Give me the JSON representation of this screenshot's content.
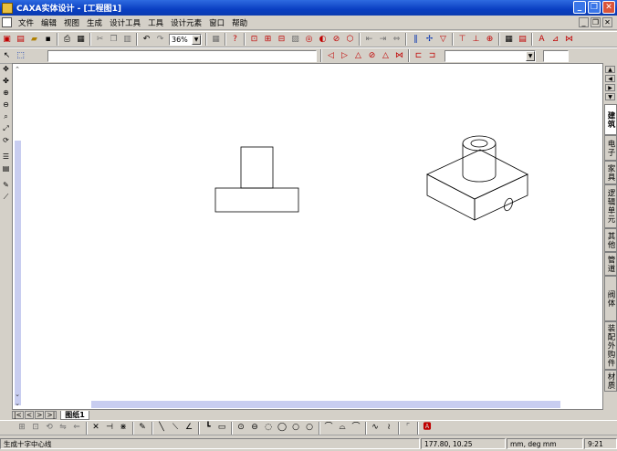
{
  "window": {
    "title": "CAXA实体设计 - [工程图1]",
    "app_icon": "CAXA"
  },
  "menu": [
    "文件",
    "编辑",
    "视图",
    "生成",
    "设计工具",
    "工具",
    "设计元素",
    "窗口",
    "帮助"
  ],
  "toolbar": {
    "zoom_value": "36%"
  },
  "sheet_tab": "图纸1",
  "right_tabs": [
    "建筑",
    "电子",
    "家具",
    "逻辑单元",
    "其他",
    "管道",
    "阀体",
    "装配外购件",
    "材质"
  ],
  "status": {
    "hint": "生成十字中心线",
    "coords": "177.80, 10.25",
    "units": "mm, deg   mm",
    "time": "9:21"
  },
  "colors": {
    "titlebar": "#0a3fc2",
    "scroll_thumb": "#c8cdf0",
    "canvas": "#ffffff"
  }
}
